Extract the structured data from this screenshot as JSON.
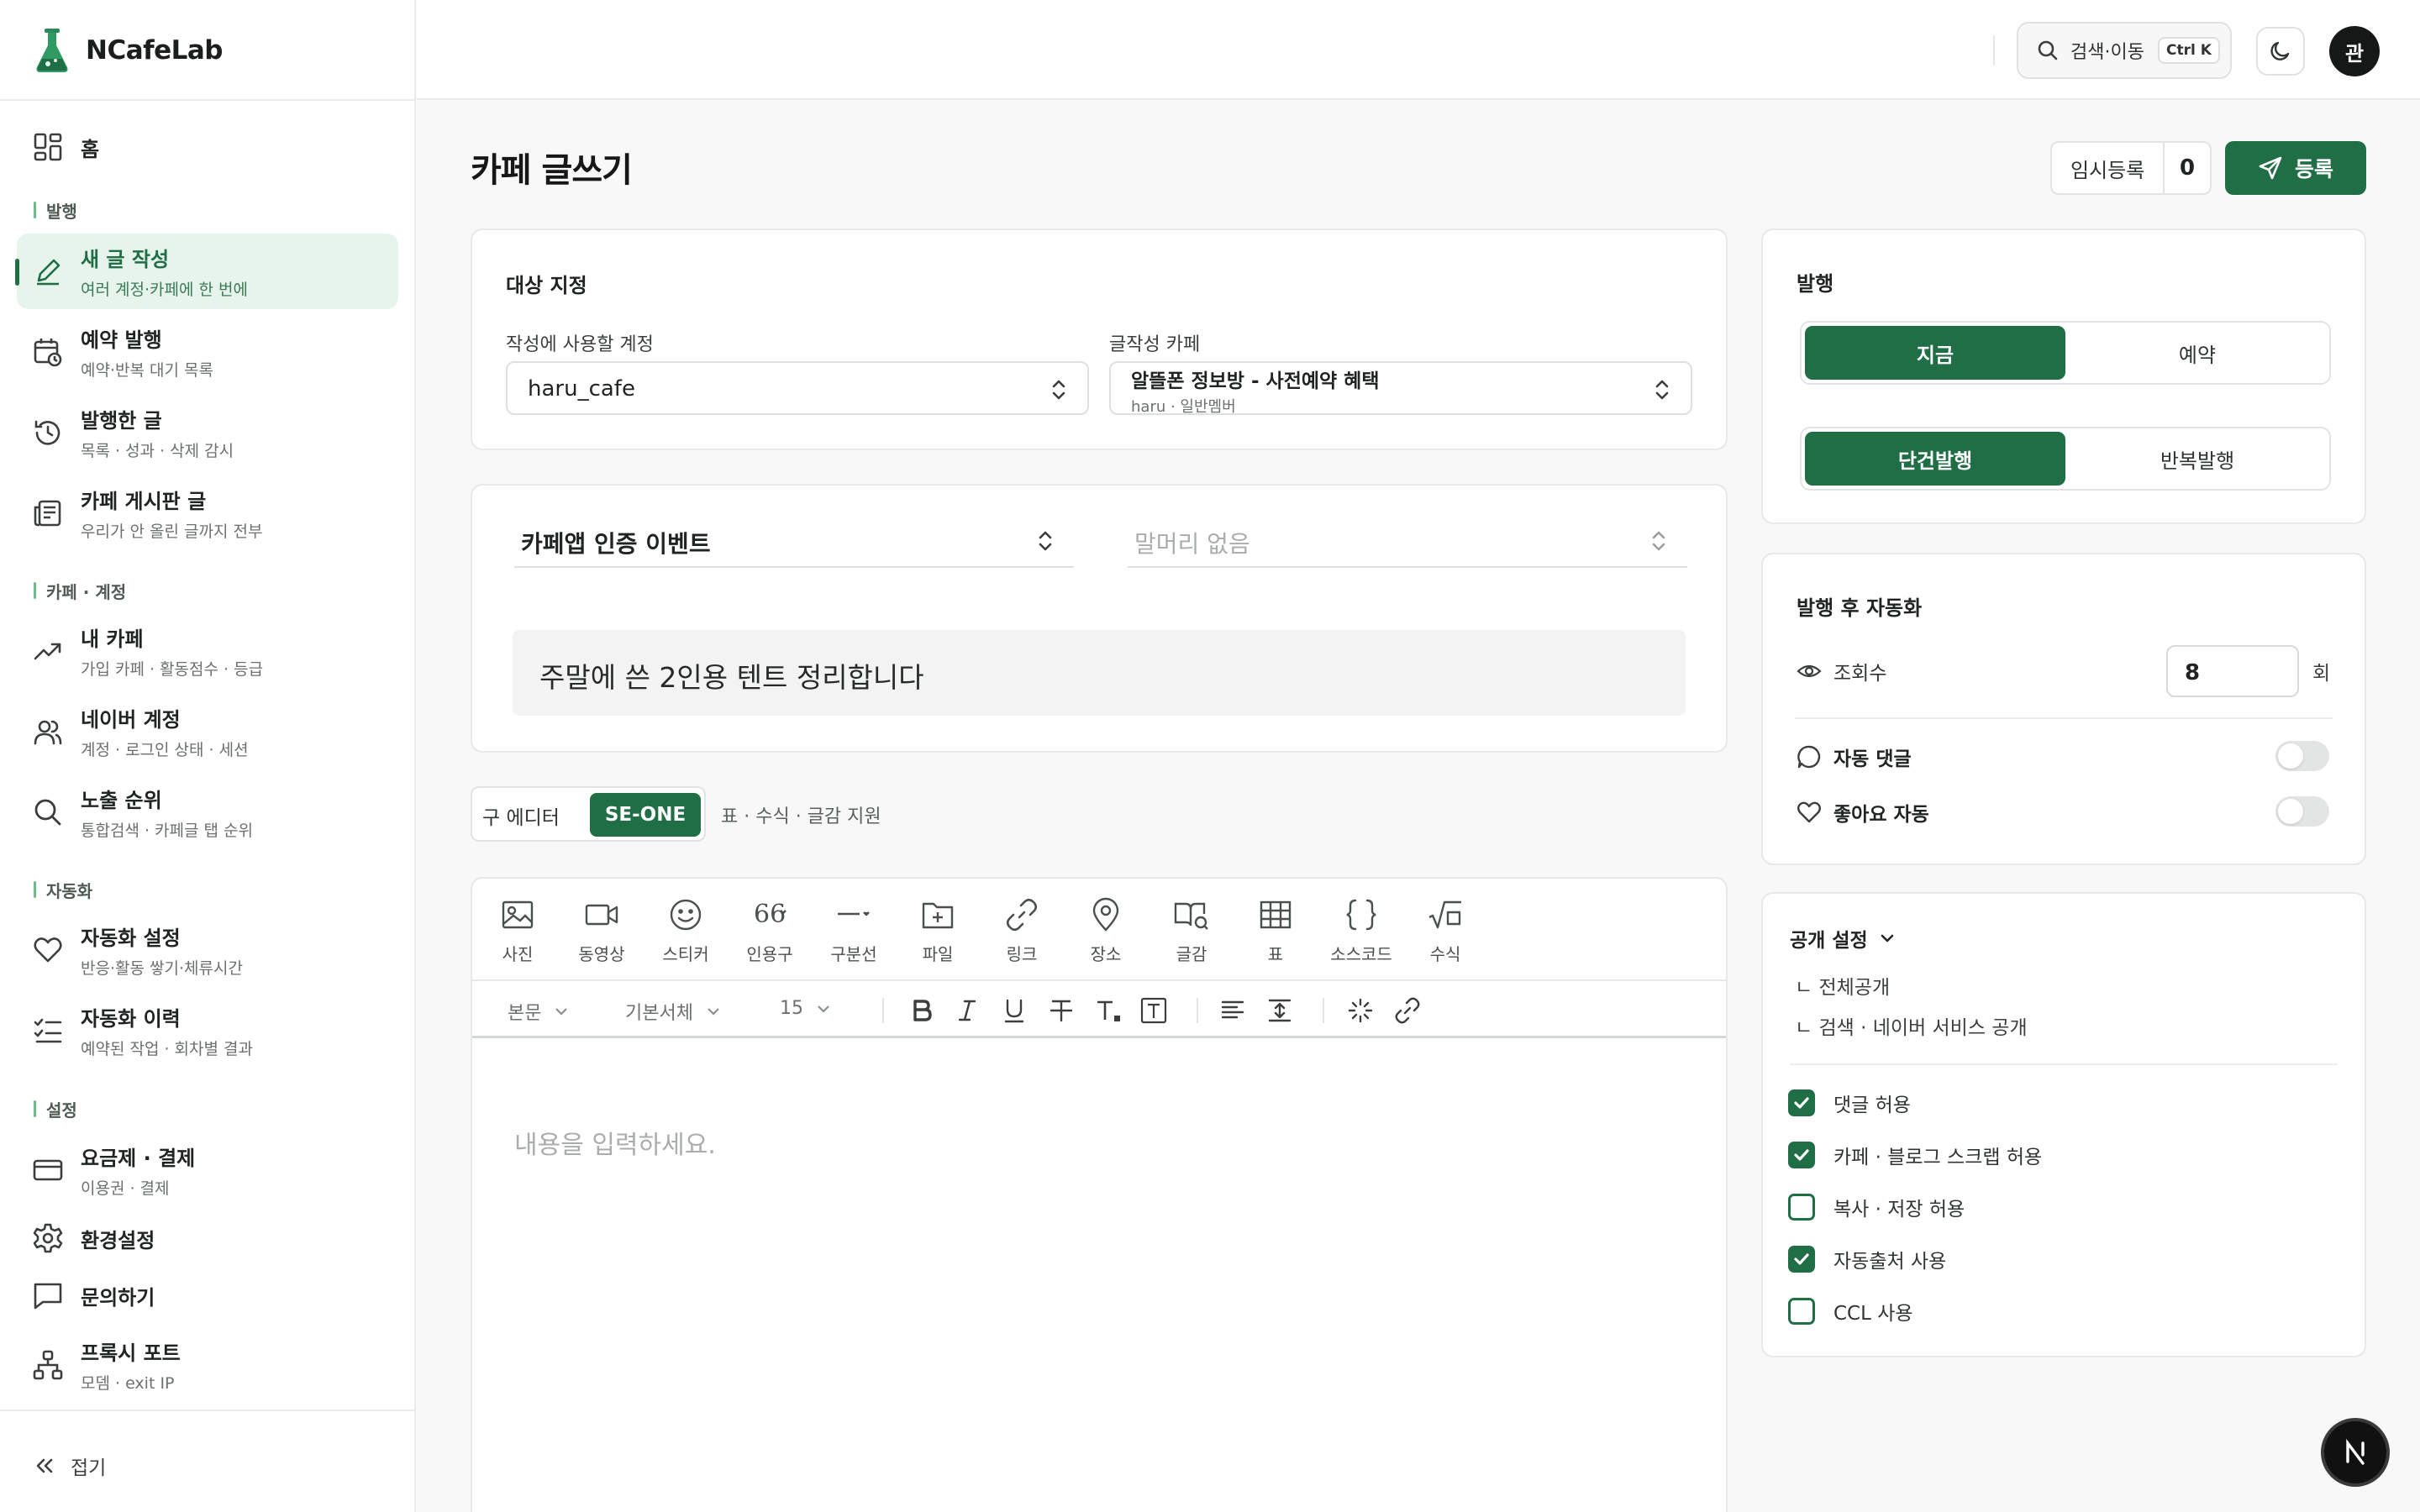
{
  "brand": {
    "name": "NCafeLab"
  },
  "sidebar": {
    "home": "홈",
    "sections": {
      "publish": "발행",
      "cafe": "카페 · 계정",
      "automation": "자동화",
      "settings": "설정"
    },
    "items": [
      {
        "label": "새 글 작성",
        "sub": "여러 계정·카페에 한 번에"
      },
      {
        "label": "예약 발행",
        "sub": "예약·반복 대기 목록"
      },
      {
        "label": "발행한 글",
        "sub": "목록 · 성과 · 삭제 감시"
      },
      {
        "label": "카페 게시판 글",
        "sub": "우리가 안 올린 글까지 전부"
      },
      {
        "label": "내 카페",
        "sub": "가입 카페 · 활동점수 · 등급"
      },
      {
        "label": "네이버 계정",
        "sub": "계정 · 로그인 상태 · 세션"
      },
      {
        "label": "노출 순위",
        "sub": "통합검색 · 카페글 탭 순위"
      },
      {
        "label": "자동화 설정",
        "sub": "반응·활동 쌓기·체류시간"
      },
      {
        "label": "자동화 이력",
        "sub": "예약된 작업 · 회차별 결과"
      },
      {
        "label": "요금제 · 결제",
        "sub": "이용권 · 결제"
      },
      {
        "label": "환경설정",
        "sub": ""
      },
      {
        "label": "문의하기",
        "sub": ""
      },
      {
        "label": "프록시 포트",
        "sub": "모뎀 · exit IP"
      }
    ],
    "collapse": "접기"
  },
  "topbar": {
    "search": "검색·이동",
    "shortcut": "Ctrl K",
    "avatar": "관"
  },
  "page": {
    "title": "카페 글쓰기",
    "draft_label": "임시등록",
    "draft_count": "0",
    "publish_label": "등록"
  },
  "target": {
    "title": "대상 지정",
    "account_label": "작성에 사용할 계정",
    "account_value": "haru_cafe",
    "cafe_label": "글작성 카페",
    "cafe_value": "알뜰폰 정보방 - 사전예약 혜택",
    "cafe_sub": "haru · 일반멤버"
  },
  "post": {
    "board": "카페앱 인증 이벤트",
    "prefix_placeholder": "말머리 없음",
    "title": "주말에 쓴 2인용 텐트 정리합니다"
  },
  "editor_mode": {
    "old": "구 에디터",
    "new": "SE-ONE",
    "note": "표 · 수식 · 글감 지원"
  },
  "toolbar": {
    "tools": [
      "사진",
      "동영상",
      "스티커",
      "인용구",
      "구분선",
      "파일",
      "링크",
      "장소",
      "글감",
      "표",
      "소스코드",
      "수식"
    ],
    "style": "본문",
    "font": "기본서체",
    "size": "15"
  },
  "editor": {
    "placeholder": "내용을 입력하세요."
  },
  "publish_panel": {
    "title": "발행",
    "now": "지금",
    "schedule": "예약",
    "single": "단건발행",
    "repeat": "반복발행"
  },
  "auto_panel": {
    "title": "발행 후 자동화",
    "views_label": "조회수",
    "views_value": "8",
    "views_unit": "회",
    "auto_comment": "자동 댓글",
    "auto_comment_on": false,
    "auto_like": "좋아요 자동",
    "auto_like_on": false
  },
  "visibility": {
    "title": "공개 설정",
    "sub1": "ㄴ 전체공개",
    "sub2": "ㄴ 검색 · 네이버 서비스 공개",
    "options": [
      {
        "label": "댓글 허용",
        "checked": true
      },
      {
        "label": "카페 · 블로그 스크랩 허용",
        "checked": true
      },
      {
        "label": "복사 · 저장 허용",
        "checked": false
      },
      {
        "label": "자동출처 사용",
        "checked": true
      },
      {
        "label": "CCL 사용",
        "checked": false
      }
    ]
  },
  "colors": {
    "accent": "#1f6e45",
    "accent_light": "#e6f4ec"
  }
}
